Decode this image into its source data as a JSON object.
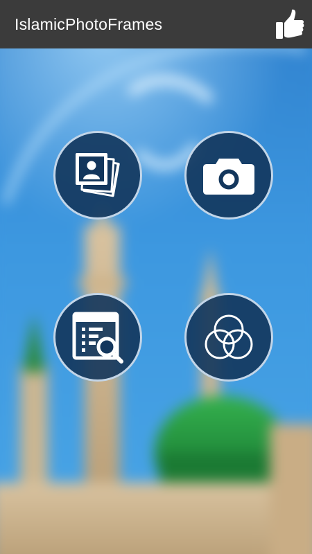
{
  "app": {
    "title": "IslamicPhotoFrames"
  },
  "actionbar": {
    "like_icon": "thumbs-up-icon",
    "background_color": "#3b3b3b"
  },
  "menu": {
    "buttons": [
      {
        "id": "gallery",
        "icon": "photo-gallery-icon"
      },
      {
        "id": "camera",
        "icon": "camera-icon"
      },
      {
        "id": "frames",
        "icon": "browse-frames-icon"
      },
      {
        "id": "effects",
        "icon": "overlapping-circles-icon"
      }
    ],
    "button_fill": "#13365c",
    "button_border": "#e1f0ff"
  },
  "background": {
    "sky_color": "#3a8fd6",
    "dome_color": "#1f8a3a"
  }
}
